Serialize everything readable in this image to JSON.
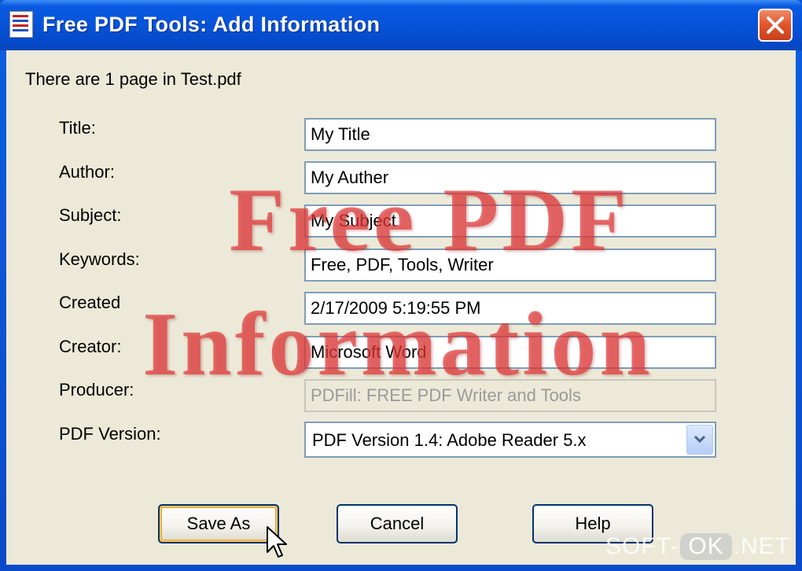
{
  "window": {
    "title": "Free PDF Tools: Add Information",
    "icon": "pdf-file-icon"
  },
  "info_text": "There are 1 page in Test.pdf",
  "fields": {
    "title": {
      "label": "Title:",
      "value": "My Title"
    },
    "author": {
      "label": "Author:",
      "value": "My Auther"
    },
    "subject": {
      "label": "Subject:",
      "value": "My Subject"
    },
    "keywords": {
      "label": "Keywords:",
      "value": "Free, PDF, Tools, Writer"
    },
    "created": {
      "label": "Created",
      "value": "2/17/2009 5:19:55 PM"
    },
    "creator": {
      "label": "Creator:",
      "value": "Microsoft Word"
    },
    "producer": {
      "label": "Producer:",
      "value": "PDFill: FREE PDF Writer and Tools"
    }
  },
  "pdf_version": {
    "label": "PDF Version:",
    "selected": "PDF Version 1.4: Adobe Reader 5.x"
  },
  "buttons": {
    "save_as": "Save As",
    "cancel": "Cancel",
    "help": "Help"
  },
  "overlay": {
    "line1": "Free PDF",
    "line2": "Information"
  },
  "site_watermark": {
    "prefix": "SOFT-",
    "ok": "OK",
    "suffix": ".NET"
  },
  "colors": {
    "titlebar": "#0653d8",
    "client_bg": "#ece9d8",
    "close_button": "#e0542a",
    "overlay_text": "#e23c3c",
    "field_border": "#7f9db9"
  }
}
